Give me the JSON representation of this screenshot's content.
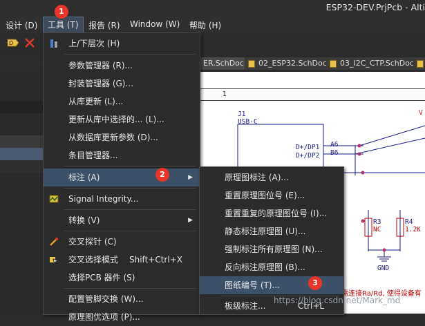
{
  "window": {
    "title": "ESP32-DEV.PrjPcb - Alti"
  },
  "menubar": [
    {
      "label": "设计 (D)"
    },
    {
      "label": "工具 (T)"
    },
    {
      "label": "报告 (R)"
    },
    {
      "label": "Window (W)"
    },
    {
      "label": "帮助 (H)"
    }
  ],
  "tabs": [
    {
      "label": "ER.SchDoc"
    },
    {
      "label": "02_ESP32.SchDoc"
    },
    {
      "label": "03_I2C_CTP.SchDoc"
    }
  ],
  "badges": [
    "1",
    "2",
    "3"
  ],
  "tools_menu": [
    {
      "label": "上/下层次 (H)",
      "icon": "hierarchy-icon"
    },
    {
      "label": "参数管理器 (R)..."
    },
    {
      "label": "封装管理器 (G)..."
    },
    {
      "label": "从库更新 (L)..."
    },
    {
      "label": "更新从库中选择的... (L)..."
    },
    {
      "label": "从数据库更新参数 (D)..."
    },
    {
      "label": "条目管理器..."
    },
    {
      "label": "标注 (A)",
      "submenu": true
    },
    {
      "label": "Signal Integrity...",
      "icon": "signal-integrity-icon"
    },
    {
      "label": "转换 (V)",
      "submenu": true
    },
    {
      "label": "交叉探针 (C)",
      "icon": "cross-probe-icon"
    },
    {
      "label": "交叉选择模式",
      "shortcut": "Shift+Ctrl+X",
      "icon": "cross-select-icon"
    },
    {
      "label": "选择PCB 器件 (S)"
    },
    {
      "label": "配置管脚交换 (W)..."
    },
    {
      "label": "原理图优选项 (P)..."
    }
  ],
  "annotate_submenu": [
    {
      "label": "原理图标注 (A)..."
    },
    {
      "label": "重置原理图位号 (E)..."
    },
    {
      "label": "重置重复的原理图位号 (I)..."
    },
    {
      "label": "静态标注原理图 (U)..."
    },
    {
      "label": "强制标注所有原理图 (N)..."
    },
    {
      "label": "反向标注原理图 (B)..."
    },
    {
      "label": "图纸编号 (T)..."
    },
    {
      "label": "板级标注...",
      "shortcut": "Ctrl+L"
    }
  ],
  "schematic": {
    "ruler_number": "1",
    "j1_ref": "J1",
    "j1_type": "USB-C",
    "pin_a6_net": "D+/DP1",
    "pin_a6": "A6",
    "pin_b6_net": "D+/DP2",
    "pin_b6": "B6",
    "r3_ref": "R3",
    "r3_val": "NC",
    "r4_ref": "R4",
    "r4_val": "1.2K",
    "gnd": "GND",
    "note": "如需连接Ra/Rd, 使得设备有",
    "vbus_fragment": "V"
  },
  "watermark": "https://blog.csdn.net/Mark_md"
}
